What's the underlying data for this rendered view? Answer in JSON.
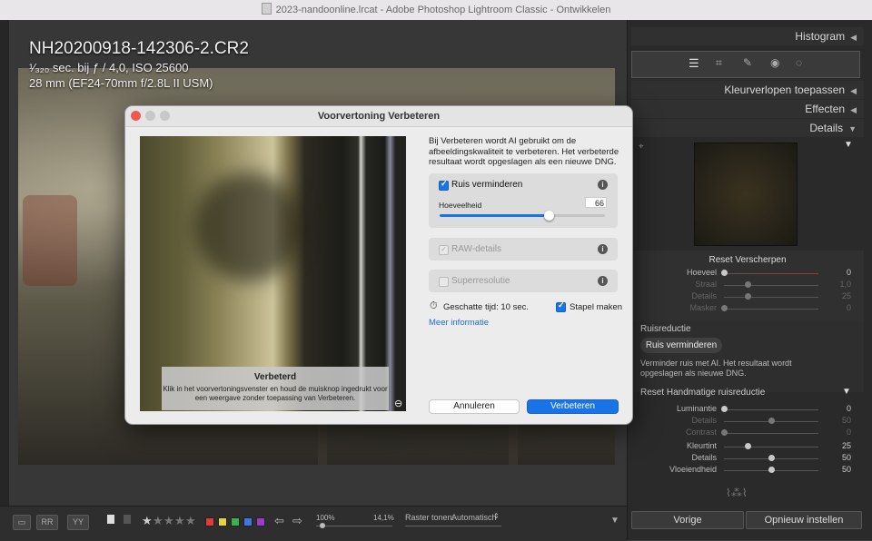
{
  "window": {
    "title": "2023-nandoonline.lrcat - Adobe Photoshop Lightroom Classic - Ontwikkelen"
  },
  "photo_info": {
    "filename": "NH20200918-142306-2.CR2",
    "exposure": "¹⁄₃₂₀ sec. bij ƒ / 4,0, ISO 25600",
    "lens": "28 mm (EF24-70mm f/2.8L II USM)"
  },
  "toolbar": {
    "zoom_left": "100%",
    "zoom_right": "14,1%",
    "raster_label": "Raster tonen:",
    "raster_value": "Automatisch",
    "label_colors": [
      "#e03a3a",
      "#e8d23a",
      "#3ab24a",
      "#3a7ae0",
      "#9a3ad0"
    ]
  },
  "right_panel": {
    "histogram": "Histogram",
    "gradients": "Kleurverlopen toepassen",
    "effects": "Effecten",
    "details": "Details",
    "sharpen_reset": "Reset Verscherpen",
    "sharpen": [
      {
        "label": "Hoeveel",
        "value": "0"
      },
      {
        "label": "Straal",
        "value": "1,0"
      },
      {
        "label": "Details",
        "value": "25"
      },
      {
        "label": "Masker",
        "value": "0"
      }
    ],
    "noise_section": "Ruisreductie",
    "noise_button": "Ruis verminderen",
    "noise_desc": "Verminder ruis met AI. Het resultaat wordt opgeslagen als nieuwe DNG.",
    "manual_reset": "Reset Handmatige ruisreductie",
    "luminance": [
      {
        "label": "Luminantie",
        "value": "0"
      },
      {
        "label": "Details",
        "value": "50"
      },
      {
        "label": "Contrast",
        "value": "0"
      }
    ],
    "color": [
      {
        "label": "Kleurtint",
        "value": "25"
      },
      {
        "label": "Details",
        "value": "50"
      },
      {
        "label": "Vloeiendheid",
        "value": "50"
      }
    ],
    "previous_button": "Vorige",
    "reset_button": "Opnieuw instellen"
  },
  "dialog": {
    "title": "Voorvertoning Verbeteren",
    "description": "Bij Verbeteren wordt AI gebruikt om de afbeeldingskwaliteit te verbeteren. Het verbeterde resultaat wordt opgeslagen als een nieuwe DNG.",
    "preview_title": "Verbeterd",
    "preview_desc": "Klik in het voorvertoningsvenster en houd de muisknop ingedrukt voor een weergave zonder toepassing van Verbeteren.",
    "denoise_label": "Ruis verminderen",
    "amount_label": "Hoeveelheid",
    "amount_value": "66",
    "amount_level": 0.66,
    "raw_details_label": "RAW-details",
    "superres_label": "Superresolutie",
    "estimate": "Geschatte tijd: 10 sec.",
    "stack_label": "Stapel maken",
    "more_info": "Meer informatie",
    "cancel": "Annuleren",
    "enhance": "Verbeteren"
  }
}
